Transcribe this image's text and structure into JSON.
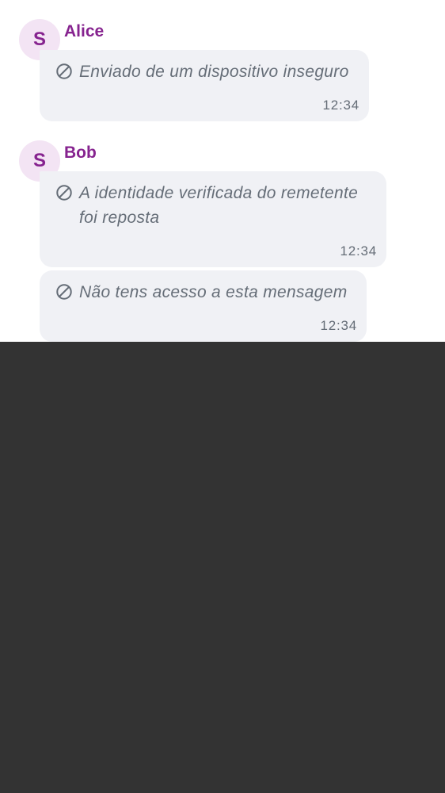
{
  "messages": [
    {
      "sender": "Alice",
      "avatar_initial": "S",
      "text": "Enviado de um dispositivo inseguro",
      "time": "12:34",
      "icon": "ban-icon"
    },
    {
      "sender": "Bob",
      "avatar_initial": "S",
      "text": "A identidade verificada do remetente foi reposta",
      "time": "12:34",
      "icon": "ban-icon"
    },
    {
      "sender": "Bob",
      "text": "Não tens acesso a esta mensagem",
      "time": "12:34",
      "icon": "ban-icon"
    }
  ],
  "colors": {
    "sender_name": "#86238f",
    "avatar_bg": "#f3e4f4",
    "bubble_bg": "#f0f1f5",
    "muted_text": "#656d77",
    "backdrop": "#333333"
  }
}
